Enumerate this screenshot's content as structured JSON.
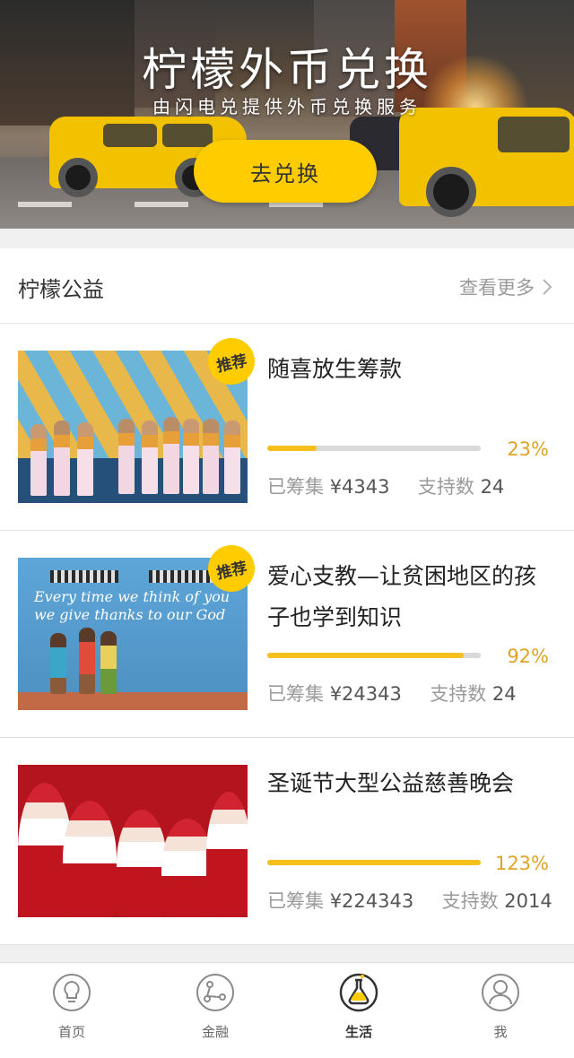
{
  "banner": {
    "title": "柠檬外币兑换",
    "subtitle": "由闪电兑提供外币兑换服务",
    "button_label": "去兑换"
  },
  "section": {
    "title": "柠檬公益",
    "more_label": "查看更多"
  },
  "items": [
    {
      "title": "随喜放生筹款",
      "badge": "推荐",
      "progress_percent": 23,
      "percent_label": "23%",
      "raised_label": "已筹集",
      "raised_value": "¥4343",
      "supporters_label": "支持数",
      "supporters_value": "24"
    },
    {
      "title": "爱心支教—让贫困地区的孩子也学到知识",
      "badge": "推荐",
      "progress_percent": 92,
      "percent_label": "92%",
      "raised_label": "已筹集",
      "raised_value": "¥24343",
      "supporters_label": "支持数",
      "supporters_value": "24",
      "image_text": "Every time we think of you we give thanks to our God"
    },
    {
      "title": "圣诞节大型公益慈善晚会",
      "progress_percent": 100,
      "percent_label": "123%",
      "raised_label": "已筹集",
      "raised_value": "¥224343",
      "supporters_label": "支持数",
      "supporters_value": "2014"
    }
  ],
  "nav": [
    {
      "label": "首页",
      "icon": "lightbulb-icon",
      "active": false
    },
    {
      "label": "金融",
      "icon": "network-icon",
      "active": false
    },
    {
      "label": "生活",
      "icon": "flask-icon",
      "active": true
    },
    {
      "label": "我",
      "icon": "user-icon",
      "active": false
    }
  ],
  "colors": {
    "accent": "#ffcc00",
    "progress": "#f5bf1c",
    "percent_text": "#e0a424",
    "muted_text": "#9a9a9a"
  }
}
